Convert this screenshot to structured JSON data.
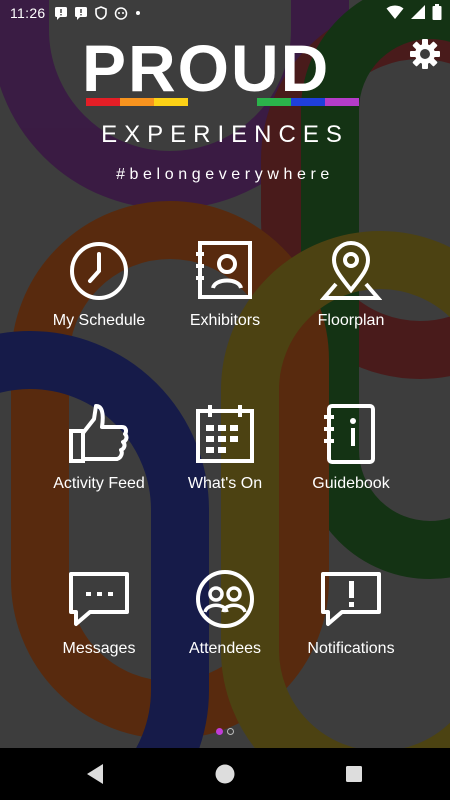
{
  "status_bar": {
    "time": "11:26",
    "left_icons": [
      "notification-icon",
      "notification-icon",
      "shield-icon",
      "cat-icon",
      "dot-icon"
    ],
    "right_icons": [
      "wifi-icon",
      "signal-icon",
      "battery-icon"
    ]
  },
  "brand": {
    "logo_main": "PROUD",
    "logo_sub": "EXPERIENCES",
    "tagline": "#belongeverywhere",
    "stripe_colors": [
      "#e41e26",
      "#f7931e",
      "#fcd116",
      "#2bb34b",
      "#1f3fdc",
      "#b53cc9"
    ]
  },
  "header": {
    "settings_icon": "gear-icon"
  },
  "menu": [
    {
      "label": "My Schedule",
      "icon": "clock-icon"
    },
    {
      "label": "Exhibitors",
      "icon": "contact-book-icon"
    },
    {
      "label": "Floorplan",
      "icon": "map-pin-icon"
    },
    {
      "label": "Activity Feed",
      "icon": "thumbs-up-icon"
    },
    {
      "label": "What's On",
      "icon": "calendar-icon"
    },
    {
      "label": "Guidebook",
      "icon": "info-book-icon"
    },
    {
      "label": "Messages",
      "icon": "chat-bubble-icon"
    },
    {
      "label": "Attendees",
      "icon": "people-icon"
    },
    {
      "label": "Notifications",
      "icon": "alert-bubble-icon"
    }
  ],
  "pager": {
    "pages": 2,
    "active": 1,
    "active_color": "#c03cd8"
  },
  "nav_bar": {
    "buttons": [
      "back-icon",
      "home-icon",
      "recents-icon"
    ]
  }
}
